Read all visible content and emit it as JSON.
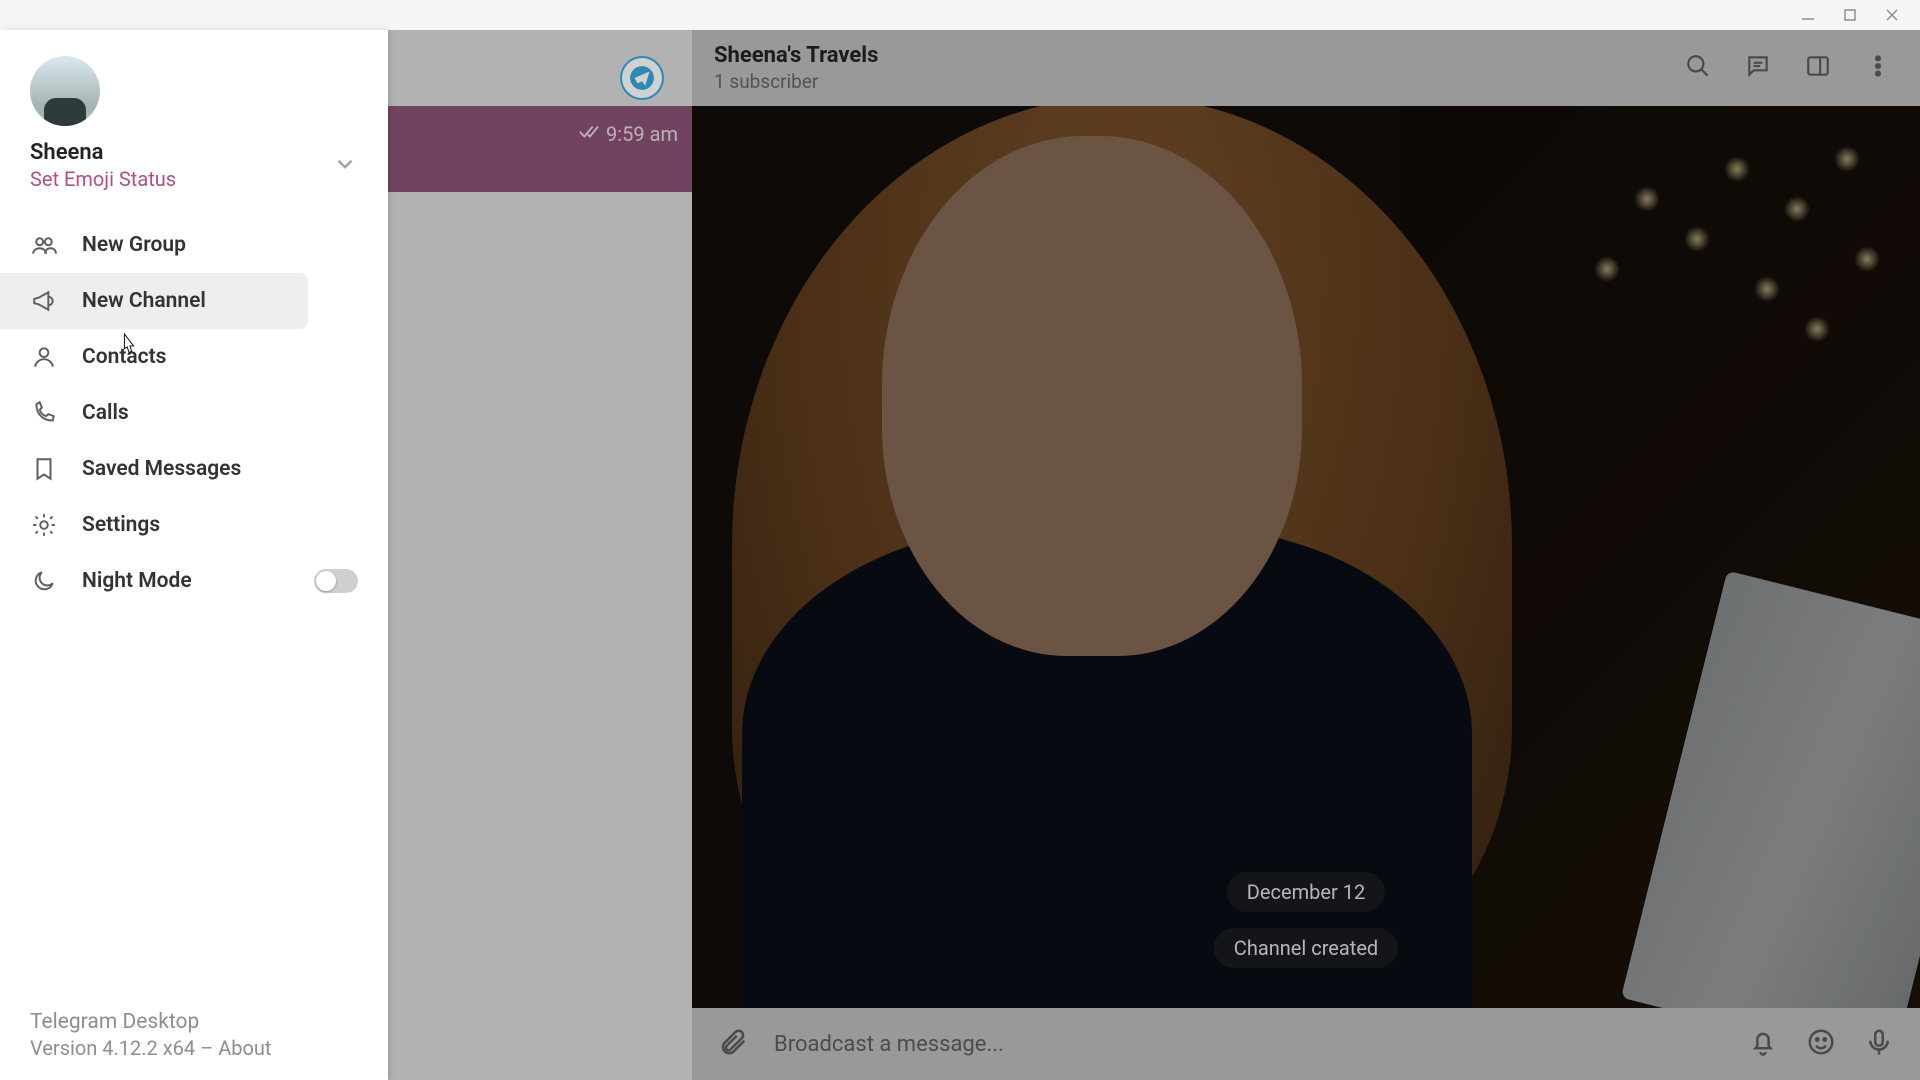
{
  "window_controls": {
    "minimize": "minimize",
    "maximize": "maximize",
    "close": "close"
  },
  "drawer": {
    "user_name": "Sheena",
    "emoji_status_label": "Set Emoji Status",
    "menu": {
      "new_group": "New Group",
      "new_channel": "New Channel",
      "contacts": "Contacts",
      "calls": "Calls",
      "saved_messages": "Saved Messages",
      "settings": "Settings",
      "night_mode": "Night Mode"
    },
    "night_mode_on": false,
    "footer": {
      "app_name": "Telegram Desktop",
      "version_line": "Version 4.12.2 x64 – About"
    }
  },
  "chatlist": {
    "selected_time": "9:59 am"
  },
  "header": {
    "title": "Sheena's Travels",
    "subscribers": "1 subscriber"
  },
  "chat": {
    "date_pill": "December 12",
    "system_msg": "Channel created"
  },
  "composer": {
    "placeholder": "Broadcast a message..."
  }
}
